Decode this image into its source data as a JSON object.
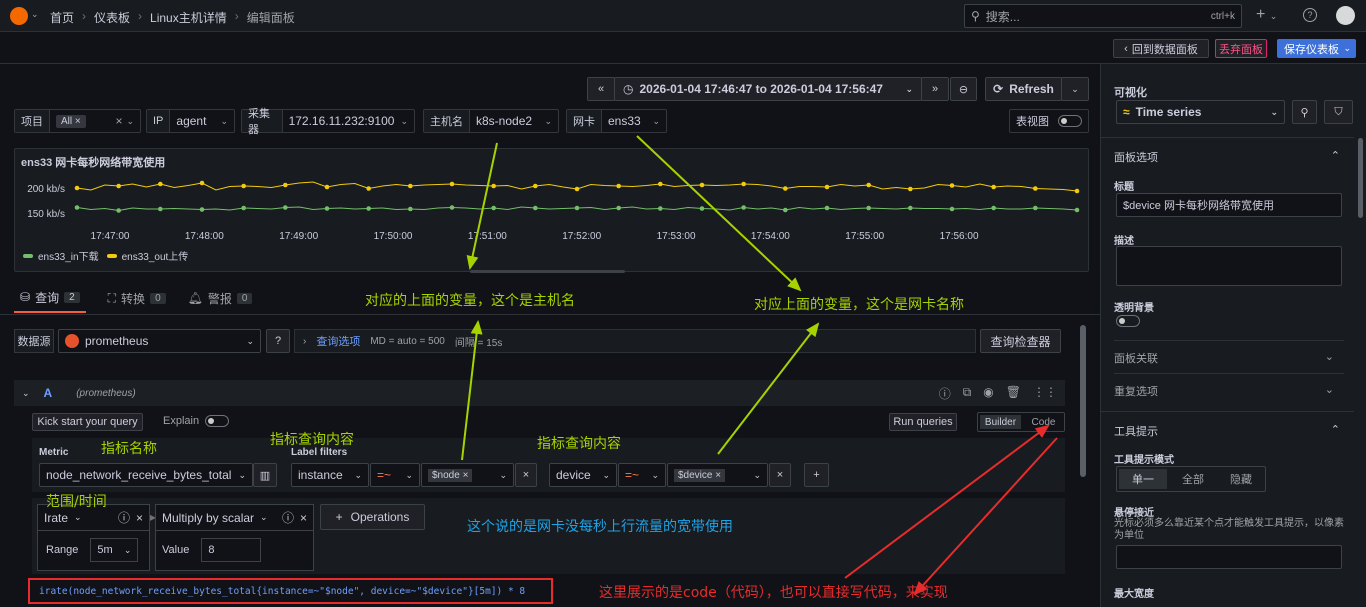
{
  "breadcrumb": {
    "home": "首页",
    "dash": "仪表板",
    "host": "Linux主机详情",
    "edit": "编辑面板"
  },
  "search": {
    "placeholder": "搜索...",
    "shortcut": "ctrl+k"
  },
  "sub": {
    "back": "回到数据面板",
    "discard": "丢弃面板",
    "save": "保存仪表板"
  },
  "time": {
    "range": "2026-01-04 17:46:47 to 2026-01-04 17:56:47",
    "refresh": "Refresh"
  },
  "vars": {
    "proj_l": "项目",
    "proj_v": "All",
    "ip_l": "IP",
    "ip_v": "agent",
    "col_l": "采集器",
    "col_v": "172.16.11.232:9100",
    "host_l": "主机名",
    "host_v": "k8s-node2",
    "nic_l": "网卡",
    "nic_v": "ens33",
    "table_view": "表视图"
  },
  "chart_data": {
    "type": "line",
    "title": "ens33 网卡每秒网络带宽使用",
    "x": [
      "17:47:00",
      "17:48:00",
      "17:49:00",
      "17:50:00",
      "17:51:00",
      "17:52:00",
      "17:53:00",
      "17:54:00",
      "17:55:00",
      "17:56:00"
    ],
    "yticks": [
      "200 kb/s",
      "150 kb/s"
    ],
    "ylim": [
      120,
      240
    ],
    "series": [
      {
        "name": "ens33_out上传",
        "color": "#f2cc0c",
        "values": [
          202,
          198,
          208,
          206,
          210,
          204,
          210,
          203,
          207,
          212,
          198,
          205,
          206,
          205,
          203,
          208,
          212,
          214,
          204,
          209,
          211,
          201,
          206,
          209,
          206,
          208,
          209,
          210,
          208,
          207,
          206,
          207,
          200,
          206,
          209,
          204,
          200,
          209,
          207,
          206,
          205,
          207,
          210,
          205,
          207,
          208,
          207,
          208,
          210,
          209,
          206,
          201,
          205,
          205,
          204,
          209,
          206,
          208,
          200,
          203,
          200,
          202,
          209,
          207,
          204,
          210,
          204,
          206,
          205,
          201,
          200,
          199,
          196
        ]
      },
      {
        "name": "ens33_in下载",
        "color": "#73bf69",
        "values": [
          163,
          159,
          161,
          157,
          162,
          160,
          160,
          161,
          160,
          159,
          160,
          158,
          162,
          161,
          160,
          163,
          164,
          159,
          161,
          162,
          160,
          161,
          162,
          159,
          160,
          159,
          162,
          163,
          162,
          160,
          162,
          159,
          164,
          162,
          160,
          161,
          162,
          163,
          159,
          162,
          164,
          160,
          161,
          159,
          163,
          161,
          160,
          158,
          163,
          160,
          162,
          158,
          163,
          160,
          162,
          159,
          161,
          162,
          161,
          160,
          162,
          161,
          161,
          160,
          161,
          159,
          162,
          160,
          160,
          162,
          161,
          160,
          158
        ]
      }
    ]
  },
  "tabs": {
    "query": "查询",
    "query_n": "2",
    "transform": "转换",
    "transform_n": "0",
    "alert": "警报",
    "alert_n": "0"
  },
  "ds": {
    "label": "数据源",
    "name": "prometheus",
    "qopts": "查询选项",
    "md": "MD = auto = 500",
    "interval": "间隔 = 15s",
    "inspector": "查询检查器"
  },
  "q": {
    "ref": "A",
    "src": "(prometheus)",
    "kick": "Kick start your query",
    "explain": "Explain",
    "run": "Run queries",
    "builder": "Builder",
    "code": "Code",
    "metric_l": "Metric",
    "metric_v": "node_network_receive_bytes_total",
    "lf_l": "Label filters",
    "f1k": "instance",
    "f1o": "=~",
    "f1v": "$node",
    "f2k": "device",
    "f2o": "=~",
    "f2v": "$device",
    "op1": "Irate",
    "range_l": "Range",
    "range_v": "5m",
    "op2": "Multiply by scalar",
    "value_l": "Value",
    "value_v": "8",
    "operations": "Operations",
    "code_line": "irate(node_network_receive_bytes_total{instance=~\"$node\", device=~\"$device\"}[5m]) * 8"
  },
  "right": {
    "viz_l": "可视化",
    "viz_v": "Time series",
    "opts": "面板选项",
    "title_l": "标题",
    "title_v": "$device 网卡每秒网络带宽使用",
    "desc_l": "描述",
    "transp_l": "透明背景",
    "links": "面板关联",
    "repeat": "重复选项",
    "tooltip": "工具提示",
    "tmode_l": "工具提示模式",
    "t_single": "单一",
    "t_all": "全部",
    "t_hidden": "隐藏",
    "hover_l": "悬停接近",
    "hover_d": "光标必须多么靠近某个点才能触发工具提示，以像素为单位",
    "maxw": "最大宽度"
  },
  "annotations": {
    "a1": "对应的上面的变量，这个是主机名",
    "a2": "对应上面的变量，这个是网卡名称",
    "a3": "指标名称",
    "a4": "指标查询内容",
    "a5": "指标查询内容",
    "a6": "范围/时间",
    "a7": "这个说的是网卡没每秒上行流量的宽带使用",
    "a8": "这里展示的是code（代码），也可以直接写代码，来实现"
  }
}
